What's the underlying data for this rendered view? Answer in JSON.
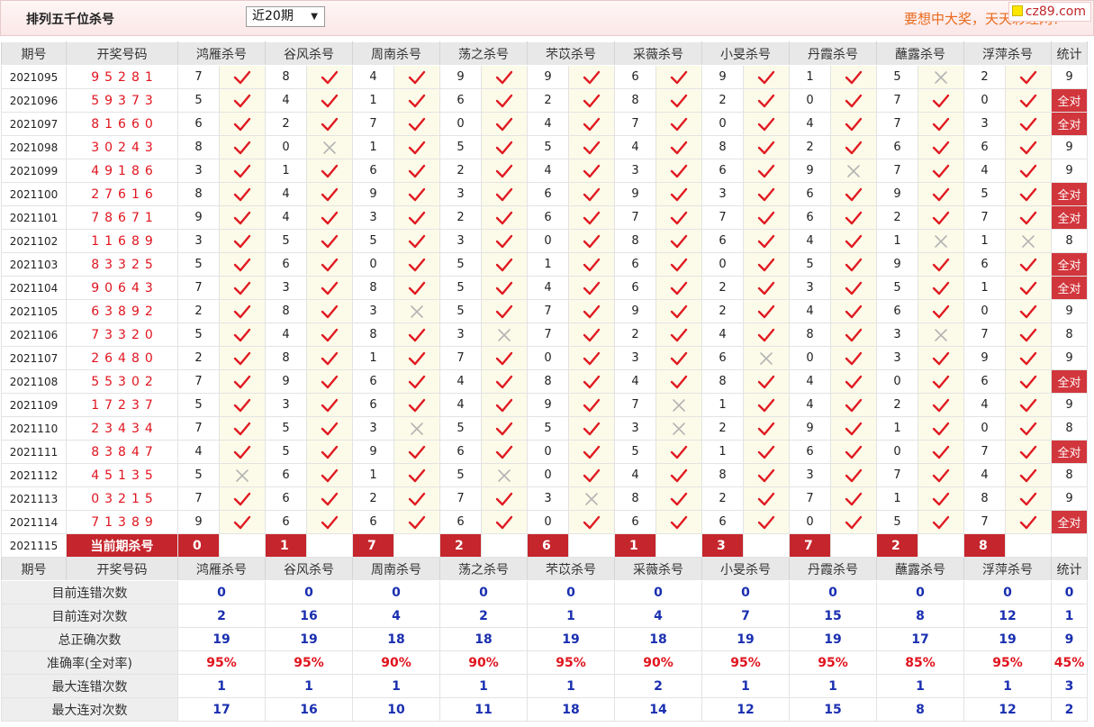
{
  "header": {
    "title": "排列五千位杀号",
    "period_select": "近20期",
    "slogan": "要想中大奖，天天彩经网！",
    "logo_text": "cz89.com"
  },
  "colors": {
    "accent_red": "#c5252c",
    "draw_red": "#e0141e",
    "stat_blue": "#1a2fb0",
    "mark_bg": "#fcfbe9"
  },
  "columns": {
    "issue": "期号",
    "draw": "开奖号码",
    "experts": [
      "鸿雁杀号",
      "谷风杀号",
      "周南杀号",
      "荡之杀号",
      "芣苡杀号",
      "采薇杀号",
      "小旻杀号",
      "丹霞杀号",
      "蘸露杀号",
      "浮萍杀号"
    ],
    "stat": "统计"
  },
  "rows": [
    {
      "issue": "2021095",
      "draw": "95281",
      "kills": [
        [
          "7",
          "right-icon"
        ],
        [
          "8",
          "right-icon"
        ],
        [
          "4",
          "right-icon"
        ],
        [
          "9",
          "right-icon"
        ],
        [
          "9",
          "right-icon"
        ],
        [
          "6",
          "right-icon"
        ],
        [
          "9",
          "right-icon"
        ],
        [
          "1",
          "right-icon"
        ],
        [
          "5",
          "wrong-icon"
        ],
        [
          "2",
          "right-icon"
        ]
      ],
      "stat": "9"
    },
    {
      "issue": "2021096",
      "draw": "59373",
      "kills": [
        [
          "5",
          "right-icon"
        ],
        [
          "4",
          "right-icon"
        ],
        [
          "1",
          "right-icon"
        ],
        [
          "6",
          "right-icon"
        ],
        [
          "2",
          "right-icon"
        ],
        [
          "8",
          "right-icon"
        ],
        [
          "2",
          "right-icon"
        ],
        [
          "0",
          "right-icon"
        ],
        [
          "7",
          "right-icon"
        ],
        [
          "0",
          "right-icon"
        ]
      ],
      "stat": "全对"
    },
    {
      "issue": "2021097",
      "draw": "81660",
      "kills": [
        [
          "6",
          "right-icon"
        ],
        [
          "2",
          "right-icon"
        ],
        [
          "7",
          "right-icon"
        ],
        [
          "0",
          "right-icon"
        ],
        [
          "4",
          "right-icon"
        ],
        [
          "7",
          "right-icon"
        ],
        [
          "0",
          "right-icon"
        ],
        [
          "4",
          "right-icon"
        ],
        [
          "7",
          "right-icon"
        ],
        [
          "3",
          "right-icon"
        ]
      ],
      "stat": "全对"
    },
    {
      "issue": "2021098",
      "draw": "30243",
      "kills": [
        [
          "8",
          "right-icon"
        ],
        [
          "0",
          "wrong-icon"
        ],
        [
          "1",
          "right-icon"
        ],
        [
          "5",
          "right-icon"
        ],
        [
          "5",
          "right-icon"
        ],
        [
          "4",
          "right-icon"
        ],
        [
          "8",
          "right-icon"
        ],
        [
          "2",
          "right-icon"
        ],
        [
          "6",
          "right-icon"
        ],
        [
          "6",
          "right-icon"
        ]
      ],
      "stat": "9"
    },
    {
      "issue": "2021099",
      "draw": "49186",
      "kills": [
        [
          "3",
          "right-icon"
        ],
        [
          "1",
          "right-icon"
        ],
        [
          "6",
          "right-icon"
        ],
        [
          "2",
          "right-icon"
        ],
        [
          "4",
          "right-icon"
        ],
        [
          "3",
          "right-icon"
        ],
        [
          "6",
          "right-icon"
        ],
        [
          "9",
          "wrong-icon"
        ],
        [
          "7",
          "right-icon"
        ],
        [
          "4",
          "right-icon"
        ]
      ],
      "stat": "9"
    },
    {
      "issue": "2021100",
      "draw": "27616",
      "kills": [
        [
          "8",
          "right-icon"
        ],
        [
          "4",
          "right-icon"
        ],
        [
          "9",
          "right-icon"
        ],
        [
          "3",
          "right-icon"
        ],
        [
          "6",
          "right-icon"
        ],
        [
          "9",
          "right-icon"
        ],
        [
          "3",
          "right-icon"
        ],
        [
          "6",
          "right-icon"
        ],
        [
          "9",
          "right-icon"
        ],
        [
          "5",
          "right-icon"
        ]
      ],
      "stat": "全对"
    },
    {
      "issue": "2021101",
      "draw": "78671",
      "kills": [
        [
          "9",
          "right-icon"
        ],
        [
          "4",
          "right-icon"
        ],
        [
          "3",
          "right-icon"
        ],
        [
          "2",
          "right-icon"
        ],
        [
          "6",
          "right-icon"
        ],
        [
          "7",
          "right-icon"
        ],
        [
          "7",
          "right-icon"
        ],
        [
          "6",
          "right-icon"
        ],
        [
          "2",
          "right-icon"
        ],
        [
          "7",
          "right-icon"
        ]
      ],
      "stat": "全对"
    },
    {
      "issue": "2021102",
      "draw": "11689",
      "kills": [
        [
          "3",
          "right-icon"
        ],
        [
          "5",
          "right-icon"
        ],
        [
          "5",
          "right-icon"
        ],
        [
          "3",
          "right-icon"
        ],
        [
          "0",
          "right-icon"
        ],
        [
          "8",
          "right-icon"
        ],
        [
          "6",
          "right-icon"
        ],
        [
          "4",
          "right-icon"
        ],
        [
          "1",
          "wrong-icon"
        ],
        [
          "1",
          "wrong-icon"
        ]
      ],
      "stat": "8"
    },
    {
      "issue": "2021103",
      "draw": "83325",
      "kills": [
        [
          "5",
          "right-icon"
        ],
        [
          "6",
          "right-icon"
        ],
        [
          "0",
          "right-icon"
        ],
        [
          "5",
          "right-icon"
        ],
        [
          "1",
          "right-icon"
        ],
        [
          "6",
          "right-icon"
        ],
        [
          "0",
          "right-icon"
        ],
        [
          "5",
          "right-icon"
        ],
        [
          "9",
          "right-icon"
        ],
        [
          "6",
          "right-icon"
        ]
      ],
      "stat": "全对"
    },
    {
      "issue": "2021104",
      "draw": "90643",
      "kills": [
        [
          "7",
          "right-icon"
        ],
        [
          "3",
          "right-icon"
        ],
        [
          "8",
          "right-icon"
        ],
        [
          "5",
          "right-icon"
        ],
        [
          "4",
          "right-icon"
        ],
        [
          "6",
          "right-icon"
        ],
        [
          "2",
          "right-icon"
        ],
        [
          "3",
          "right-icon"
        ],
        [
          "5",
          "right-icon"
        ],
        [
          "1",
          "right-icon"
        ]
      ],
      "stat": "全对"
    },
    {
      "issue": "2021105",
      "draw": "63892",
      "kills": [
        [
          "2",
          "right-icon"
        ],
        [
          "8",
          "right-icon"
        ],
        [
          "3",
          "wrong-icon"
        ],
        [
          "5",
          "right-icon"
        ],
        [
          "7",
          "right-icon"
        ],
        [
          "9",
          "right-icon"
        ],
        [
          "2",
          "right-icon"
        ],
        [
          "4",
          "right-icon"
        ],
        [
          "6",
          "right-icon"
        ],
        [
          "0",
          "right-icon"
        ]
      ],
      "stat": "9"
    },
    {
      "issue": "2021106",
      "draw": "73320",
      "kills": [
        [
          "5",
          "right-icon"
        ],
        [
          "4",
          "right-icon"
        ],
        [
          "8",
          "right-icon"
        ],
        [
          "3",
          "wrong-icon"
        ],
        [
          "7",
          "right-icon"
        ],
        [
          "2",
          "right-icon"
        ],
        [
          "4",
          "right-icon"
        ],
        [
          "8",
          "right-icon"
        ],
        [
          "3",
          "wrong-icon"
        ],
        [
          "7",
          "right-icon"
        ]
      ],
      "stat": "8"
    },
    {
      "issue": "2021107",
      "draw": "26480",
      "kills": [
        [
          "2",
          "right-icon"
        ],
        [
          "8",
          "right-icon"
        ],
        [
          "1",
          "right-icon"
        ],
        [
          "7",
          "right-icon"
        ],
        [
          "0",
          "right-icon"
        ],
        [
          "3",
          "right-icon"
        ],
        [
          "6",
          "wrong-icon"
        ],
        [
          "0",
          "right-icon"
        ],
        [
          "3",
          "right-icon"
        ],
        [
          "9",
          "right-icon"
        ]
      ],
      "stat": "9"
    },
    {
      "issue": "2021108",
      "draw": "55302",
      "kills": [
        [
          "7",
          "right-icon"
        ],
        [
          "9",
          "right-icon"
        ],
        [
          "6",
          "right-icon"
        ],
        [
          "4",
          "right-icon"
        ],
        [
          "8",
          "right-icon"
        ],
        [
          "4",
          "right-icon"
        ],
        [
          "8",
          "right-icon"
        ],
        [
          "4",
          "right-icon"
        ],
        [
          "0",
          "right-icon"
        ],
        [
          "6",
          "right-icon"
        ]
      ],
      "stat": "全对"
    },
    {
      "issue": "2021109",
      "draw": "17237",
      "kills": [
        [
          "5",
          "right-icon"
        ],
        [
          "3",
          "right-icon"
        ],
        [
          "6",
          "right-icon"
        ],
        [
          "4",
          "right-icon"
        ],
        [
          "9",
          "right-icon"
        ],
        [
          "7",
          "wrong-icon"
        ],
        [
          "1",
          "right-icon"
        ],
        [
          "4",
          "right-icon"
        ],
        [
          "2",
          "right-icon"
        ],
        [
          "4",
          "right-icon"
        ]
      ],
      "stat": "9"
    },
    {
      "issue": "2021110",
      "draw": "23434",
      "kills": [
        [
          "7",
          "right-icon"
        ],
        [
          "5",
          "right-icon"
        ],
        [
          "3",
          "wrong-icon"
        ],
        [
          "5",
          "right-icon"
        ],
        [
          "5",
          "right-icon"
        ],
        [
          "3",
          "wrong-icon"
        ],
        [
          "2",
          "right-icon"
        ],
        [
          "9",
          "right-icon"
        ],
        [
          "1",
          "right-icon"
        ],
        [
          "0",
          "right-icon"
        ]
      ],
      "stat": "8"
    },
    {
      "issue": "2021111",
      "draw": "83847",
      "kills": [
        [
          "4",
          "right-icon"
        ],
        [
          "5",
          "right-icon"
        ],
        [
          "9",
          "right-icon"
        ],
        [
          "6",
          "right-icon"
        ],
        [
          "0",
          "right-icon"
        ],
        [
          "5",
          "right-icon"
        ],
        [
          "1",
          "right-icon"
        ],
        [
          "6",
          "right-icon"
        ],
        [
          "0",
          "right-icon"
        ],
        [
          "7",
          "right-icon"
        ]
      ],
      "stat": "全对"
    },
    {
      "issue": "2021112",
      "draw": "45135",
      "kills": [
        [
          "5",
          "wrong-icon"
        ],
        [
          "6",
          "right-icon"
        ],
        [
          "1",
          "right-icon"
        ],
        [
          "5",
          "wrong-icon"
        ],
        [
          "0",
          "right-icon"
        ],
        [
          "4",
          "right-icon"
        ],
        [
          "8",
          "right-icon"
        ],
        [
          "3",
          "right-icon"
        ],
        [
          "7",
          "right-icon"
        ],
        [
          "4",
          "right-icon"
        ]
      ],
      "stat": "8"
    },
    {
      "issue": "2021113",
      "draw": "03215",
      "kills": [
        [
          "7",
          "right-icon"
        ],
        [
          "6",
          "right-icon"
        ],
        [
          "2",
          "right-icon"
        ],
        [
          "7",
          "right-icon"
        ],
        [
          "3",
          "wrong-icon"
        ],
        [
          "8",
          "right-icon"
        ],
        [
          "2",
          "right-icon"
        ],
        [
          "7",
          "right-icon"
        ],
        [
          "1",
          "right-icon"
        ],
        [
          "8",
          "right-icon"
        ]
      ],
      "stat": "9"
    },
    {
      "issue": "2021114",
      "draw": "71389",
      "kills": [
        [
          "9",
          "right-icon"
        ],
        [
          "6",
          "right-icon"
        ],
        [
          "6",
          "right-icon"
        ],
        [
          "6",
          "right-icon"
        ],
        [
          "0",
          "right-icon"
        ],
        [
          "6",
          "right-icon"
        ],
        [
          "6",
          "right-icon"
        ],
        [
          "0",
          "right-icon"
        ],
        [
          "5",
          "right-icon"
        ],
        [
          "7",
          "right-icon"
        ]
      ],
      "stat": "全对"
    }
  ],
  "current": {
    "issue": "2021115",
    "label": "当前期杀号",
    "kills": [
      "0",
      "1",
      "7",
      "2",
      "6",
      "1",
      "3",
      "7",
      "2",
      "8"
    ]
  },
  "stats": [
    {
      "label": "目前连错次数",
      "values": [
        "0",
        "0",
        "0",
        "0",
        "0",
        "0",
        "0",
        "0",
        "0",
        "0"
      ],
      "stat": "0",
      "pct": false
    },
    {
      "label": "目前连对次数",
      "values": [
        "2",
        "16",
        "4",
        "2",
        "1",
        "4",
        "7",
        "15",
        "8",
        "12"
      ],
      "stat": "1",
      "pct": false
    },
    {
      "label": "总正确次数",
      "values": [
        "19",
        "19",
        "18",
        "18",
        "19",
        "18",
        "19",
        "19",
        "17",
        "19"
      ],
      "stat": "9",
      "pct": false
    },
    {
      "label": "准确率(全对率)",
      "values": [
        "95%",
        "95%",
        "90%",
        "90%",
        "95%",
        "90%",
        "95%",
        "95%",
        "85%",
        "95%"
      ],
      "stat": "45%",
      "pct": true
    },
    {
      "label": "最大连错次数",
      "values": [
        "1",
        "1",
        "1",
        "1",
        "1",
        "2",
        "1",
        "1",
        "1",
        "1"
      ],
      "stat": "3",
      "pct": false
    },
    {
      "label": "最大连对次数",
      "values": [
        "17",
        "16",
        "10",
        "11",
        "18",
        "14",
        "12",
        "15",
        "8",
        "12"
      ],
      "stat": "2",
      "pct": false
    }
  ]
}
